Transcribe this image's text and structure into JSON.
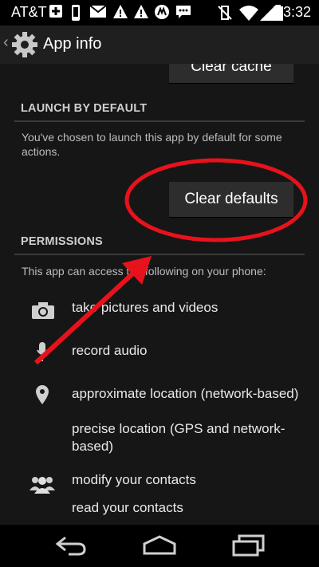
{
  "status_bar": {
    "carrier": "AT&T",
    "time": "3:32"
  },
  "action_bar": {
    "title": "App info"
  },
  "storage": {
    "clear_cache_label": "Clear cache"
  },
  "launch_by_default": {
    "header": "LAUNCH BY DEFAULT",
    "description": "You've chosen to launch this app by default for some actions.",
    "clear_defaults_label": "Clear defaults"
  },
  "permissions": {
    "header": "PERMISSIONS",
    "intro": "This app can access the following on your phone:",
    "groups": [
      {
        "icon": "camera-icon",
        "items": [
          "take pictures and videos"
        ]
      },
      {
        "icon": "microphone-icon",
        "items": [
          "record audio"
        ]
      },
      {
        "icon": "location-pin-icon",
        "items": [
          "approximate location (network-based)",
          "precise location (GPS and network-based)"
        ]
      },
      {
        "icon": "contacts-icon",
        "items": [
          "modify your contacts",
          "read your contacts"
        ]
      }
    ]
  },
  "annotation": {
    "highlight_color": "#e8121c"
  }
}
